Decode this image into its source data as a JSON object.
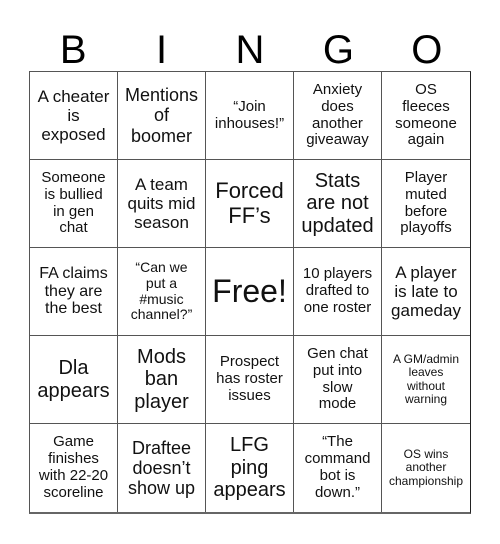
{
  "header": {
    "letters": [
      "B",
      "I",
      "N",
      "G",
      "O"
    ]
  },
  "card": {
    "rows": [
      [
        {
          "text": "A cheater\nis\nexposed",
          "size": "s17"
        },
        {
          "text": "Mentions\nof\nboomer",
          "size": "s18"
        },
        {
          "text": "“Join\ninhouses!”",
          "size": "s15"
        },
        {
          "text": "Anxiety\ndoes\nanother\ngiveaway",
          "size": "s15"
        },
        {
          "text": "OS\nfleeces\nsomeone\nagain",
          "size": "s15"
        }
      ],
      [
        {
          "text": "Someone\nis bullied\nin gen\nchat",
          "size": "s15"
        },
        {
          "text": "A team\nquits mid\nseason",
          "size": "s17"
        },
        {
          "text": "Forced\nFF’s",
          "size": "s22"
        },
        {
          "text": "Stats\nare not\nupdated",
          "size": "s20"
        },
        {
          "text": "Player\nmuted\nbefore\nplayoffs",
          "size": "s15"
        }
      ],
      [
        {
          "text": "FA claims\nthey are\nthe best",
          "size": "s16"
        },
        {
          "text": "“Can we\nput a\n#music\nchannel?”",
          "size": "s14"
        },
        {
          "text": "Free!",
          "size": "s32"
        },
        {
          "text": "10 players\ndrafted to\none roster",
          "size": "s15"
        },
        {
          "text": "A player\nis late to\ngameday",
          "size": "s17"
        }
      ],
      [
        {
          "text": "Dla\nappears",
          "size": "s20"
        },
        {
          "text": "Mods\nban\nplayer",
          "size": "s20"
        },
        {
          "text": "Prospect\nhas roster\nissues",
          "size": "s15"
        },
        {
          "text": "Gen chat\nput into\nslow\nmode",
          "size": "s15"
        },
        {
          "text": "A GM/admin\nleaves\nwithout\nwarning",
          "size": "s12"
        }
      ],
      [
        {
          "text": "Game\nfinishes\nwith 22-20\nscoreline",
          "size": "s15"
        },
        {
          "text": "Draftee\ndoesn’t\nshow up",
          "size": "s18"
        },
        {
          "text": "LFG\nping\nappears",
          "size": "s20"
        },
        {
          "text": "“The\ncommand\nbot is\ndown.”",
          "size": "s15"
        },
        {
          "text": "OS wins\nanother\nchampionship",
          "size": "s12"
        }
      ]
    ]
  }
}
